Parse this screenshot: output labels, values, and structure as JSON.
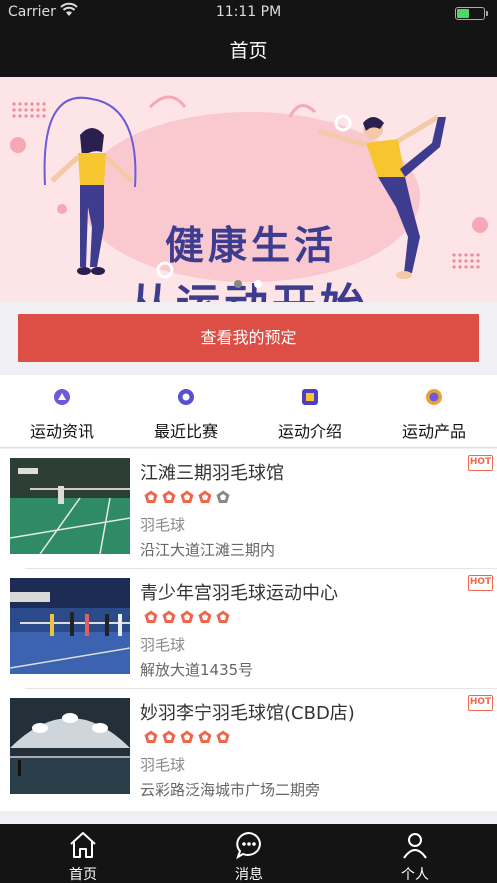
{
  "status_bar": {
    "carrier": "Carrier",
    "time": "11:11 PM"
  },
  "nav": {
    "title": "首页"
  },
  "banner": {
    "line1": "健康生活",
    "line2": "从运动开始",
    "active_page": 1,
    "page_count": 2
  },
  "reserve_button": "查看我的预定",
  "quick_menu": [
    {
      "label": "运动资讯",
      "icon": "news-icon",
      "color": "#6a5bd8"
    },
    {
      "label": "最近比赛",
      "icon": "match-icon",
      "color": "#5a4fd0"
    },
    {
      "label": "运动介绍",
      "icon": "intro-icon",
      "color": "#4d3fbf"
    },
    {
      "label": "运动产品",
      "icon": "product-icon",
      "color": "#e8a23a"
    }
  ],
  "venues": [
    {
      "name": "江滩三期羽毛球馆",
      "rating": 4,
      "sport": "羽毛球",
      "address": "沿江大道江滩三期内",
      "badge": "HOT"
    },
    {
      "name": "青少年宫羽毛球运动中心",
      "rating": 5,
      "sport": "羽毛球",
      "address": "解放大道1435号",
      "badge": "HOT"
    },
    {
      "name": "妙羽李宁羽毛球馆(CBD店)",
      "rating": 5,
      "sport": "羽毛球",
      "address": "云彩路泛海城市广场二期旁",
      "badge": "HOT"
    }
  ],
  "tabs": [
    {
      "label": "首页",
      "icon": "home-icon"
    },
    {
      "label": "消息",
      "icon": "message-icon"
    },
    {
      "label": "个人",
      "icon": "profile-icon"
    }
  ],
  "colors": {
    "accent": "#dd4e44",
    "hot": "#f0664d",
    "star_on": "#f0664d",
    "star_off": "#888888",
    "bar": "#141414"
  }
}
